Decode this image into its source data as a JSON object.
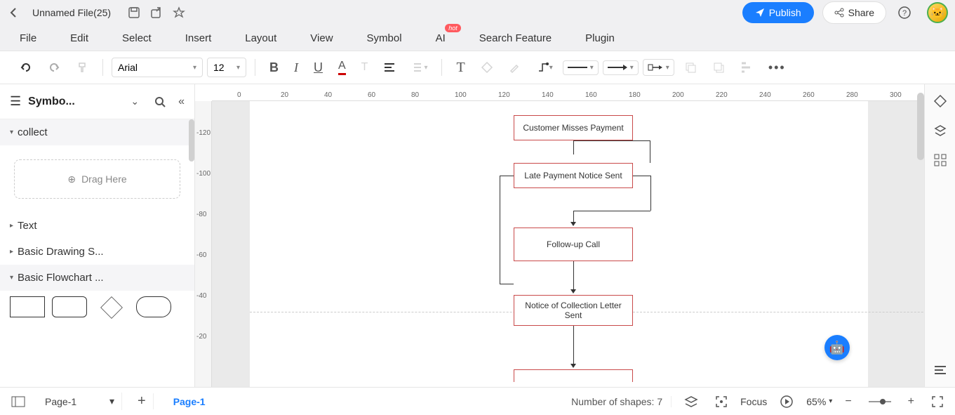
{
  "titlebar": {
    "filename": "Unnamed File(25)",
    "publish_label": "Publish",
    "share_label": "Share"
  },
  "menubar": {
    "items": [
      "File",
      "Edit",
      "Select",
      "Insert",
      "Layout",
      "View",
      "Symbol",
      "AI",
      "Search Feature",
      "Plugin"
    ],
    "hot_badge": "hot"
  },
  "toolbar": {
    "font": "Arial",
    "size": "12"
  },
  "sidebar": {
    "title": "Symbo...",
    "sections": {
      "collect": "collect",
      "drag_here": "Drag Here",
      "text": "Text",
      "basic_drawing": "Basic Drawing S...",
      "basic_flowchart": "Basic Flowchart ..."
    }
  },
  "ruler_h": [
    "0",
    "20",
    "40",
    "60",
    "80",
    "100",
    "120",
    "140",
    "160",
    "180",
    "200",
    "220",
    "240",
    "260",
    "280",
    "300"
  ],
  "ruler_v": [
    "-120",
    "-100",
    "-80",
    "-60",
    "-40",
    "-20"
  ],
  "nodes": {
    "n1": "Customer Misses Payment",
    "n2": "Late Payment Notice Sent",
    "n3": "Follow-up Call",
    "n4": "Notice of Collection Letter Sent"
  },
  "statusbar": {
    "page_select": "Page-1",
    "active_page": "Page-1",
    "shape_count": "Number of shapes: 7",
    "focus": "Focus",
    "zoom": "65%"
  }
}
